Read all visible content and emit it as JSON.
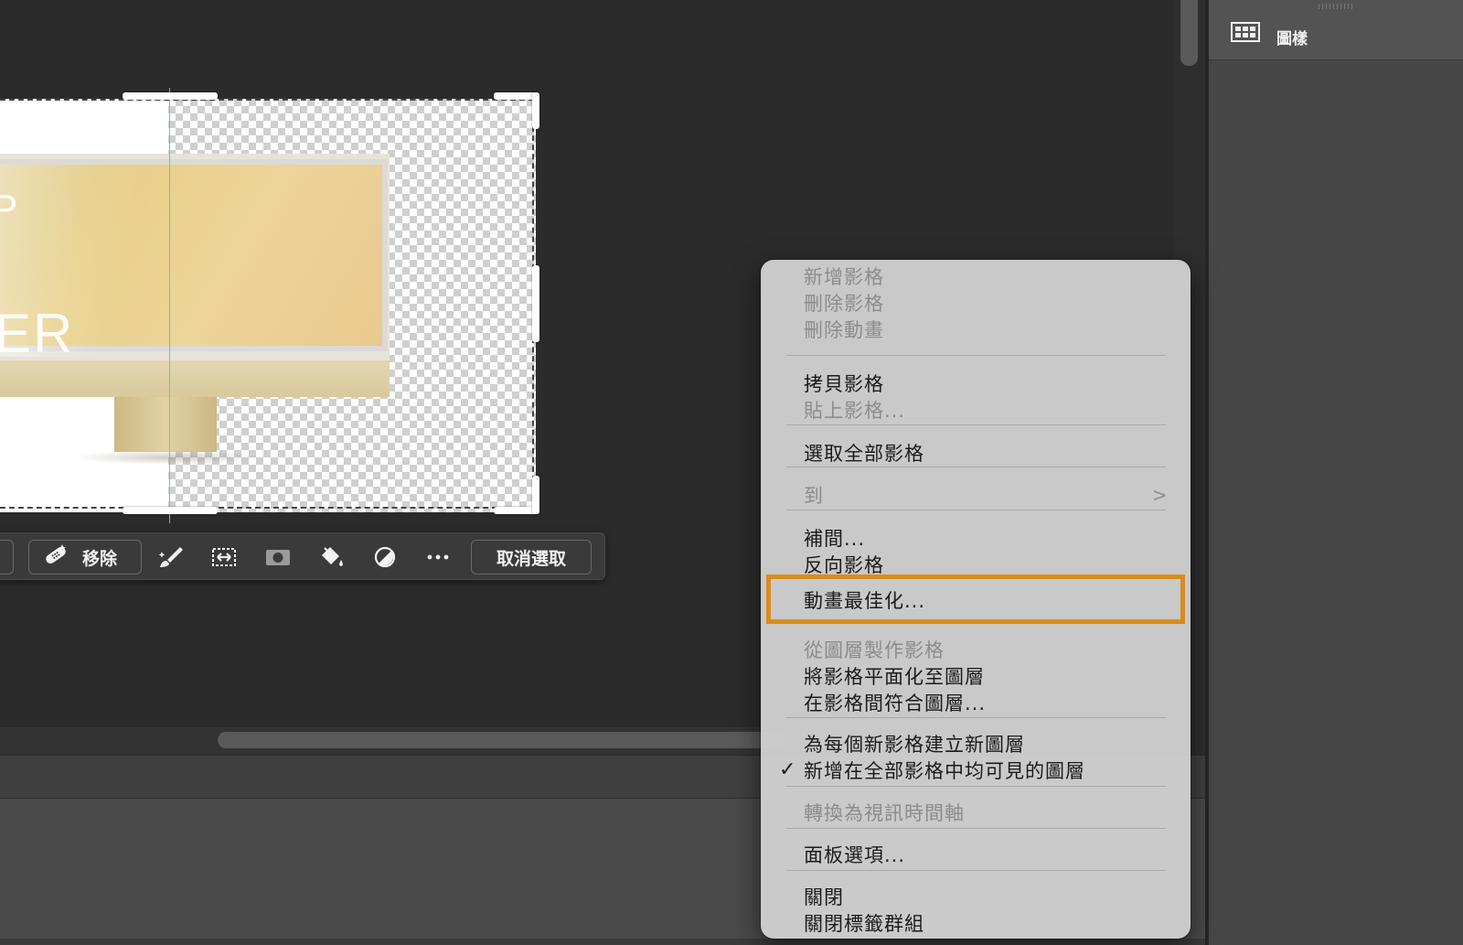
{
  "canvas": {
    "artwork_text_top": "P",
    "artwork_text": "ER"
  },
  "task_bar": {
    "remove_label": "移除",
    "deselect_label": "取消選取",
    "icons": [
      "bandage-icon",
      "brush-icon",
      "transform-icon",
      "mask-icon",
      "fill-bucket-icon",
      "adjustment-icon",
      "more-icon"
    ]
  },
  "right_panel": {
    "tab_label": "圖樣",
    "tab_icon": "pattern-icon"
  },
  "context_menu": {
    "items": [
      {
        "label": "新增影格",
        "enabled": false
      },
      {
        "label": "刪除影格",
        "enabled": false
      },
      {
        "label": "刪除動畫",
        "enabled": false
      },
      {
        "label": "拷貝影格",
        "enabled": true
      },
      {
        "label": "貼上影格...",
        "enabled": false
      },
      {
        "label": "選取全部影格",
        "enabled": true
      },
      {
        "label": "到",
        "enabled": false,
        "submenu": true
      },
      {
        "label": "補間...",
        "enabled": true
      },
      {
        "label": "反向影格",
        "enabled": true
      },
      {
        "label": "動畫最佳化...",
        "enabled": true,
        "highlighted": true
      },
      {
        "label": "從圖層製作影格",
        "enabled": false
      },
      {
        "label": "將影格平面化至圖層",
        "enabled": true
      },
      {
        "label": "在影格間符合圖層...",
        "enabled": true
      },
      {
        "label": "為每個新影格建立新圖層",
        "enabled": true
      },
      {
        "label": "新增在全部影格中均可見的圖層",
        "enabled": true,
        "checked": true
      },
      {
        "label": "轉換為視訊時間軸",
        "enabled": false
      },
      {
        "label": "面板選項...",
        "enabled": true
      },
      {
        "label": "關閉",
        "enabled": true
      },
      {
        "label": "關閉標籤群組",
        "enabled": true
      }
    ],
    "submenu_arrow": ">",
    "check_mark": "✓",
    "highlight_color": "#d78c1e"
  }
}
